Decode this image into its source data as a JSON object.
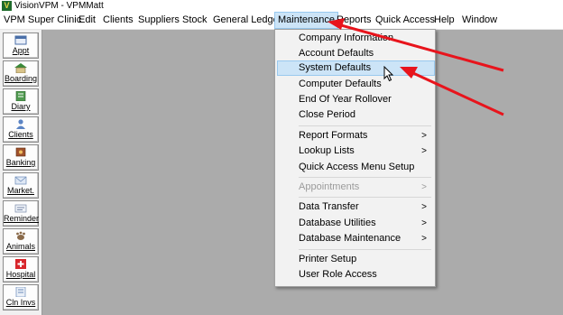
{
  "window": {
    "title": "VisionVPM - VPMMatt"
  },
  "menubar": {
    "items": [
      {
        "label": "VPM Super Clinic"
      },
      {
        "label": "Edit"
      },
      {
        "label": "Clients"
      },
      {
        "label": "Suppliers"
      },
      {
        "label": "Stock"
      },
      {
        "label": "General Ledger"
      },
      {
        "label": "Maintenance"
      },
      {
        "label": "Reports"
      },
      {
        "label": "Quick Access"
      },
      {
        "label": "Help"
      },
      {
        "label": "Window"
      }
    ]
  },
  "toolbar": {
    "buttons": [
      {
        "label": "Appt",
        "icon": "calendar-icon"
      },
      {
        "label": "Boarding",
        "icon": "house-icon"
      },
      {
        "label": "Diary",
        "icon": "diary-icon"
      },
      {
        "label": "Clients",
        "icon": "person-icon"
      },
      {
        "label": "Banking",
        "icon": "safe-icon"
      },
      {
        "label": "Market.",
        "icon": "envelope-icon"
      },
      {
        "label": "Reminder",
        "icon": "reminder-icon"
      },
      {
        "label": "Animals",
        "icon": "animal-icon"
      },
      {
        "label": "Hospital",
        "icon": "hospital-cross-icon"
      },
      {
        "label": "Cln Invs",
        "icon": "invoice-icon"
      }
    ]
  },
  "maintenance_menu": {
    "items": [
      {
        "label": "Company Information",
        "submenu": false,
        "enabled": true
      },
      {
        "label": "Account Defaults",
        "submenu": false,
        "enabled": true
      },
      {
        "label": "System Defaults",
        "submenu": false,
        "enabled": true,
        "highlighted": true
      },
      {
        "label": "Computer Defaults",
        "submenu": false,
        "enabled": true
      },
      {
        "label": "End Of Year Rollover",
        "submenu": false,
        "enabled": true
      },
      {
        "label": "Close Period",
        "submenu": false,
        "enabled": true
      },
      {
        "label": "Report Formats",
        "submenu": true,
        "enabled": true
      },
      {
        "label": "Lookup Lists",
        "submenu": true,
        "enabled": true
      },
      {
        "label": "Quick Access Menu Setup",
        "submenu": false,
        "enabled": true
      },
      {
        "label": "Appointments",
        "submenu": true,
        "enabled": false
      },
      {
        "label": "Data Transfer",
        "submenu": true,
        "enabled": true
      },
      {
        "label": "Database Utilities",
        "submenu": true,
        "enabled": true
      },
      {
        "label": "Database Maintenance",
        "submenu": true,
        "enabled": true
      },
      {
        "label": "Printer Setup",
        "submenu": false,
        "enabled": true
      },
      {
        "label": "User Role Access",
        "submenu": false,
        "enabled": true
      }
    ],
    "submenu_arrow": ">"
  },
  "colors": {
    "highlight": "#cce4f7",
    "highlight_border": "#99c9ef",
    "workspace": "#ababab",
    "annotation_arrow": "#e8141c"
  }
}
